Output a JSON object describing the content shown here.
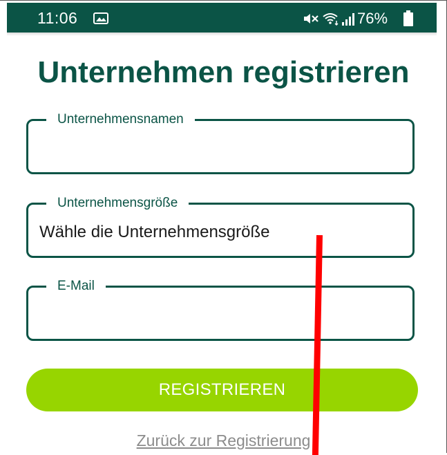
{
  "status_bar": {
    "time": "11:06",
    "battery_percent": "76%",
    "icons": [
      "image-icon",
      "mute-icon",
      "wifi-icon",
      "signal-icon",
      "battery-icon"
    ],
    "background": "#0b5446"
  },
  "page": {
    "title": "Unternehmen registrieren"
  },
  "form": {
    "company_name": {
      "label": "Unternehmensnamen",
      "value": ""
    },
    "company_size": {
      "label": "Unternehmensgröße",
      "value": "Wähle die Unternehmensgröße"
    },
    "email": {
      "label": "E-Mail",
      "value": ""
    }
  },
  "actions": {
    "register_label": "REGISTRIEREN",
    "back_link": "Zurück zur Registrierung"
  },
  "colors": {
    "primary": "#0b5446",
    "button": "#97d500",
    "link": "#8c8c8c",
    "annotation_line": "#ff0000"
  }
}
